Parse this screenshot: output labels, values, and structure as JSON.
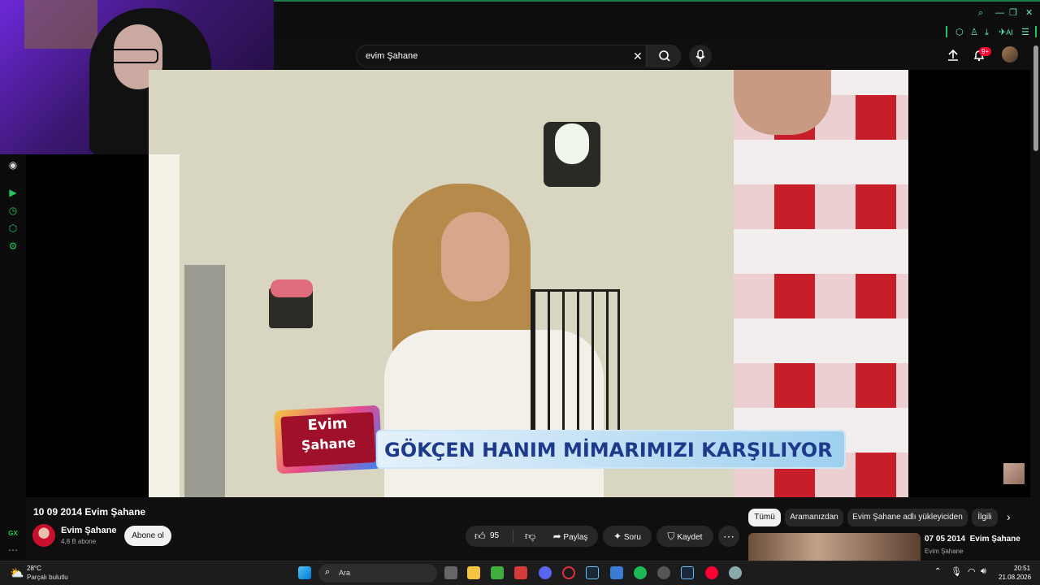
{
  "browser": {
    "ai_label": "AI"
  },
  "youtube": {
    "search": {
      "value": "evim Şahane"
    },
    "notifications_badge": "9+"
  },
  "video": {
    "logo_line1": "Evim",
    "logo_line2": "Şahane",
    "lower_third": "GÖKÇEN HANIM MİMARIMIZI KARŞILIYOR"
  },
  "watch": {
    "title": "10 09 2014 Evim Şahane",
    "channel": {
      "name": "Evim Şahane",
      "subscribers": "4,8 B abone",
      "subscribe_label": "Abone ol"
    },
    "actions": {
      "likes": "95",
      "share": "Paylaş",
      "ask": "Soru",
      "save": "Kaydet"
    }
  },
  "recommendations": {
    "chips": [
      "Tümü",
      "Aramanızdan",
      "Evim Şahane adlı yükleyiciden",
      "İlgili"
    ],
    "first": {
      "title": "07 05 2014  Evim Şahane",
      "channel": "Evim Şahane"
    }
  },
  "taskbar": {
    "weather_temp": "28°C",
    "weather_desc": "Parçalı bulutlu",
    "search_placeholder": "Ara",
    "time": "20:51",
    "date": "21.08.2026",
    "gx_label": "GX"
  },
  "colors": {
    "gx_accent": "#22c55e",
    "yt_red": "#ff0033",
    "lower_third_blue": "#1e3a8a"
  }
}
